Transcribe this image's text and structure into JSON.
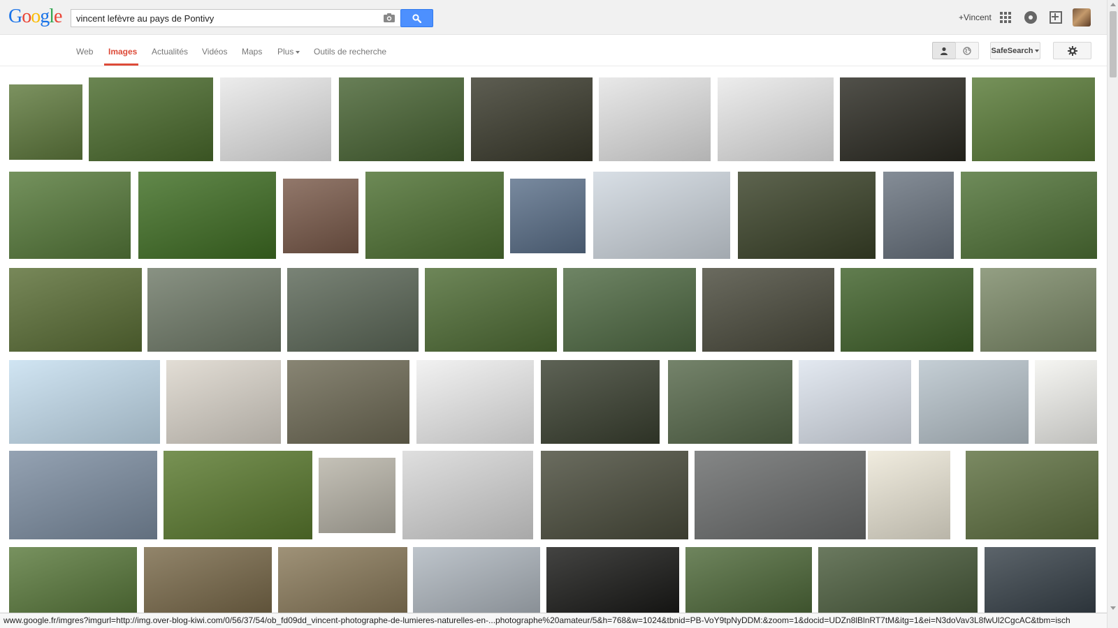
{
  "search": {
    "query": "vincent lefèvre au pays de Pontivy",
    "logo": [
      "G",
      "o",
      "o",
      "g",
      "l",
      "e"
    ],
    "logo_colors": [
      "#1a73e8",
      "#ea4335",
      "#fbbc05",
      "#1a73e8",
      "#34a853",
      "#ea4335"
    ]
  },
  "header": {
    "user_link": "+Vincent"
  },
  "nav": {
    "tabs": [
      "Web",
      "Images",
      "Actualités",
      "Vidéos",
      "Maps",
      "Plus",
      "Outils de recherche"
    ],
    "active_tab": "Images"
  },
  "tools": {
    "safesearch_label": "SafeSearch"
  },
  "results": {
    "rows": [
      [
        "#5f7a3d",
        "#4a6b2c",
        "#e8e8e8",
        "#476332",
        "#3a3a2c",
        "#e4e4e4",
        "#e9e9e9",
        "#2b2a22",
        "#587a36"
      ],
      [
        "#567a3a",
        "#3f6e23",
        "#7a5a4a",
        "#4d7031",
        "#5b708a",
        "#d0d8e0",
        "#3a4228",
        "#6a7480",
        "#4f7236"
      ],
      [
        "#5a6e35",
        "#6f7a68",
        "#5c6858",
        "#4e6c34",
        "#4f6a43",
        "#4a4a3c",
        "#3f6129",
        "#7c8a68"
      ],
      [
        "#c6dff0",
        "#dcd6cc",
        "#6e6a55",
        "#efefef",
        "#3a4030",
        "#56684a",
        "#dde4ee",
        "#b8c4cc",
        "#f4f4f0"
      ],
      [
        "#7d8ea2",
        "#5a7a2e",
        "#b8b4a8",
        "#d8d8d8",
        "#4a4c3c",
        "#6a6c6c",
        "#ede8d8",
        "#5e7040"
      ],
      [
        "#5a7a3c",
        "#7a6a4a",
        "#8a7a5a",
        "#b0b8c0",
        "#1a1a18",
        "#4f6a3a",
        "#4a5c3c",
        "#38424a"
      ]
    ]
  }
}
